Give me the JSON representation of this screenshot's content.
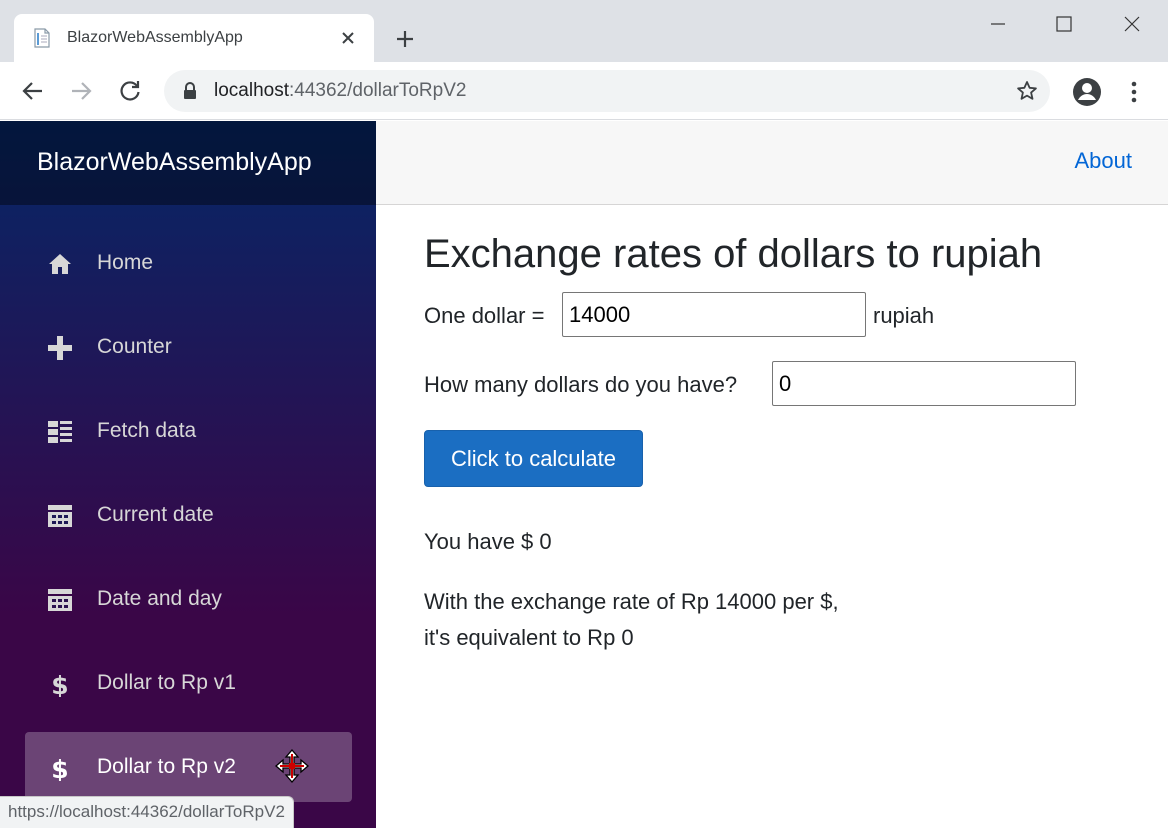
{
  "browser": {
    "tab_title": "BlazorWebAssemblyApp",
    "url_host": "localhost",
    "url_rest": ":44362/dollarToRpV2",
    "status_url": "https://localhost:44362/dollarToRpV2"
  },
  "sidebar": {
    "brand": "BlazorWebAssemblyApp",
    "items": [
      {
        "label": "Home",
        "icon": "home-icon"
      },
      {
        "label": "Counter",
        "icon": "plus-icon"
      },
      {
        "label": "Fetch data",
        "icon": "list-icon"
      },
      {
        "label": "Current date",
        "icon": "calendar-icon"
      },
      {
        "label": "Date and day",
        "icon": "calendar-icon"
      },
      {
        "label": "Dollar to Rp v1",
        "icon": "dollar-icon"
      },
      {
        "label": "Dollar to Rp v2",
        "icon": "dollar-icon",
        "active": true
      }
    ]
  },
  "top_row": {
    "about": "About"
  },
  "main": {
    "heading": "Exchange rates of dollars to rupiah",
    "one_dollar_label": "One dollar =",
    "rate_value": "14000",
    "rupiah_label": "rupiah",
    "dollars_label": "How many dollars do you have?",
    "dollars_value": "0",
    "button_label": "Click to calculate",
    "result_line": "You have $ 0",
    "rate_line": "With the exchange rate of Rp 14000 per $,",
    "equivalent_line": "it's equivalent to Rp 0"
  },
  "colors": {
    "accent": "#1b6ec2",
    "link": "#0366d6",
    "sidebar_top": "#052767",
    "sidebar_bottom": "#3a0647"
  }
}
